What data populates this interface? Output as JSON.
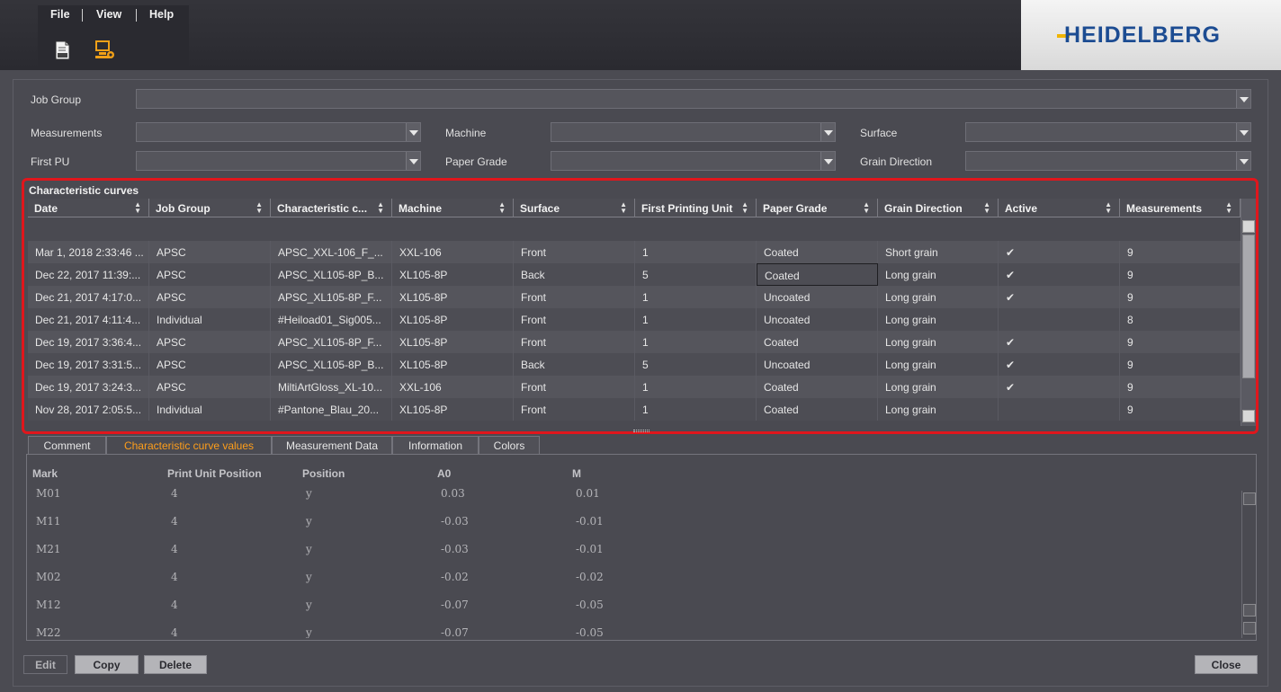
{
  "menu": {
    "file": "File",
    "view": "View",
    "help": "Help"
  },
  "toolbar": {
    "icon1": "document-abc-icon",
    "icon2": "computer-settings-icon"
  },
  "brand": {
    "logo_text": "HEIDELBERG",
    "color": "#1c4c92"
  },
  "filters": {
    "job_group": {
      "label": "Job Group",
      "value": ""
    },
    "measurements": {
      "label": "Measurements",
      "value": ""
    },
    "machine": {
      "label": "Machine",
      "value": ""
    },
    "surface": {
      "label": "Surface",
      "value": ""
    },
    "first_pu": {
      "label": "First PU",
      "value": ""
    },
    "paper_grade": {
      "label": "Paper Grade",
      "value": ""
    },
    "grain_direction": {
      "label": "Grain Direction",
      "value": ""
    }
  },
  "curves": {
    "title": "Characteristic curves",
    "columns": [
      "Date",
      "Job Group",
      "Characteristic c...",
      "Machine",
      "Surface",
      "First Printing Unit",
      "Paper Grade",
      "Grain Direction",
      "Active",
      "Measurements"
    ],
    "rows": [
      [
        "Mar 1, 2018  2:33:46 ...",
        "APSC",
        "APSC_XXL-106_F_...",
        "XXL-106",
        "Front",
        "1",
        "Coated",
        "Short grain",
        "✔",
        "9"
      ],
      [
        "Dec 22, 2017  11:39:...",
        "APSC",
        "APSC_XL105-8P_B...",
        "XL105-8P",
        "Back",
        "5",
        "Coated",
        "Long grain",
        "✔",
        "9"
      ],
      [
        "Dec 21, 2017  4:17:0...",
        "APSC",
        "APSC_XL105-8P_F...",
        "XL105-8P",
        "Front",
        "1",
        "Uncoated",
        "Long grain",
        "✔",
        "9"
      ],
      [
        "Dec 21, 2017  4:11:4...",
        "Individual",
        "#Heiload01_Sig005...",
        "XL105-8P",
        "Front",
        "1",
        "Uncoated",
        "Long grain",
        "",
        "8"
      ],
      [
        "Dec 19, 2017  3:36:4...",
        "APSC",
        "APSC_XL105-8P_F...",
        "XL105-8P",
        "Front",
        "1",
        "Coated",
        "Long grain",
        "✔",
        "9"
      ],
      [
        "Dec 19, 2017  3:31:5...",
        "APSC",
        "APSC_XL105-8P_B...",
        "XL105-8P",
        "Back",
        "5",
        "Uncoated",
        "Long grain",
        "✔",
        "9"
      ],
      [
        "Dec 19, 2017  3:24:3...",
        "APSC",
        "MiltiArtGloss_XL-10...",
        "XXL-106",
        "Front",
        "1",
        "Coated",
        "Long grain",
        "✔",
        "9"
      ],
      [
        "Nov 28, 2017  2:05:5...",
        "Individual",
        "#Pantone_Blau_20...",
        "XL105-8P",
        "Front",
        "1",
        "Coated",
        "Long grain",
        "",
        "9"
      ]
    ]
  },
  "tabs": [
    "Comment",
    "Characteristic curve values",
    "Measurement Data",
    "Information",
    "Colors"
  ],
  "values": {
    "columns": [
      "Mark",
      "Print Unit Position",
      "Position",
      "A0",
      "M"
    ],
    "rows": [
      [
        "M01",
        "4",
        "y",
        "0.03",
        "0.01"
      ],
      [
        "M11",
        "4",
        "y",
        "-0.03",
        "-0.01"
      ],
      [
        "M21",
        "4",
        "y",
        "-0.03",
        "-0.01"
      ],
      [
        "M02",
        "4",
        "y",
        "-0.02",
        "-0.02"
      ],
      [
        "M12",
        "4",
        "y",
        "-0.07",
        "-0.05"
      ],
      [
        "M22",
        "4",
        "y",
        "-0.07",
        "-0.05"
      ]
    ]
  },
  "buttons": {
    "edit": "Edit",
    "copy": "Copy",
    "delete": "Delete",
    "close": "Close"
  },
  "colors": {
    "accent": "#ff9e1a",
    "highlight": "#e0161c"
  }
}
